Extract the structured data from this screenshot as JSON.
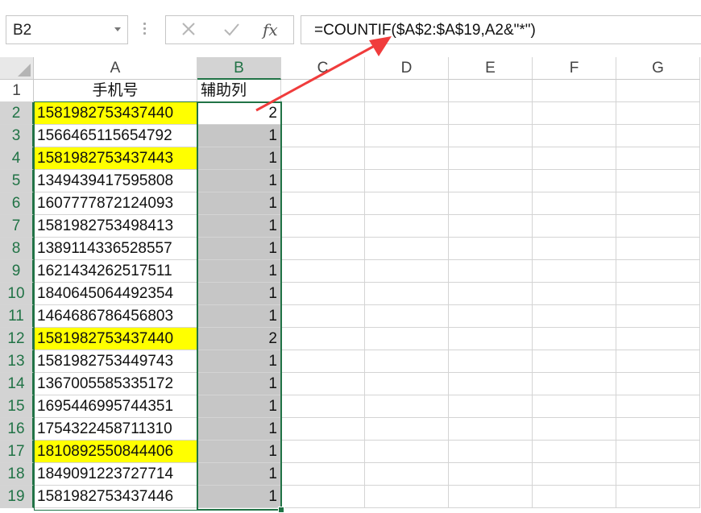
{
  "name_box": {
    "value": "B2"
  },
  "formula_bar": {
    "cancel_glyph": "✕",
    "enter_glyph": "✓",
    "fx_label": "fx",
    "formula": "=COUNTIF($A$2:$A$19,A2&\"*\")"
  },
  "columns": [
    "A",
    "B",
    "C",
    "D",
    "E",
    "F",
    "G"
  ],
  "rows": [
    "1",
    "2",
    "3",
    "4",
    "5",
    "6",
    "7",
    "8",
    "9",
    "10",
    "11",
    "12",
    "13",
    "14",
    "15",
    "16",
    "17",
    "18",
    "19"
  ],
  "cells": {
    "header_a": "手机号",
    "header_b": "辅助列",
    "data": [
      {
        "a": "1581982753437440",
        "b": "2",
        "hl": true
      },
      {
        "a": "1566465115654792",
        "b": "1",
        "hl": false
      },
      {
        "a": "1581982753437443",
        "b": "1",
        "hl": true
      },
      {
        "a": "1349439417595808",
        "b": "1",
        "hl": false
      },
      {
        "a": "1607777872124093",
        "b": "1",
        "hl": false
      },
      {
        "a": "1581982753498413",
        "b": "1",
        "hl": false
      },
      {
        "a": "1389114336528557",
        "b": "1",
        "hl": false
      },
      {
        "a": "1621434262517511",
        "b": "1",
        "hl": false
      },
      {
        "a": "1840645064492354",
        "b": "1",
        "hl": false
      },
      {
        "a": "1464686786456803",
        "b": "1",
        "hl": false
      },
      {
        "a": "1581982753437440",
        "b": "2",
        "hl": true
      },
      {
        "a": "1581982753449743",
        "b": "1",
        "hl": false
      },
      {
        "a": "1367005585335172",
        "b": "1",
        "hl": false
      },
      {
        "a": "1695446995744351",
        "b": "1",
        "hl": false
      },
      {
        "a": "1754322458711310",
        "b": "1",
        "hl": false
      },
      {
        "a": "1810892550844406",
        "b": "1",
        "hl": true
      },
      {
        "a": "1849091223727714",
        "b": "1",
        "hl": false
      },
      {
        "a": "1581982753437446",
        "b": "1",
        "hl": false
      }
    ]
  },
  "colors": {
    "highlight": "#ffff00",
    "selection": "#217346",
    "arrow": "#f03c3c"
  },
  "active_cell": "B2",
  "selected_range": "B2:B19"
}
